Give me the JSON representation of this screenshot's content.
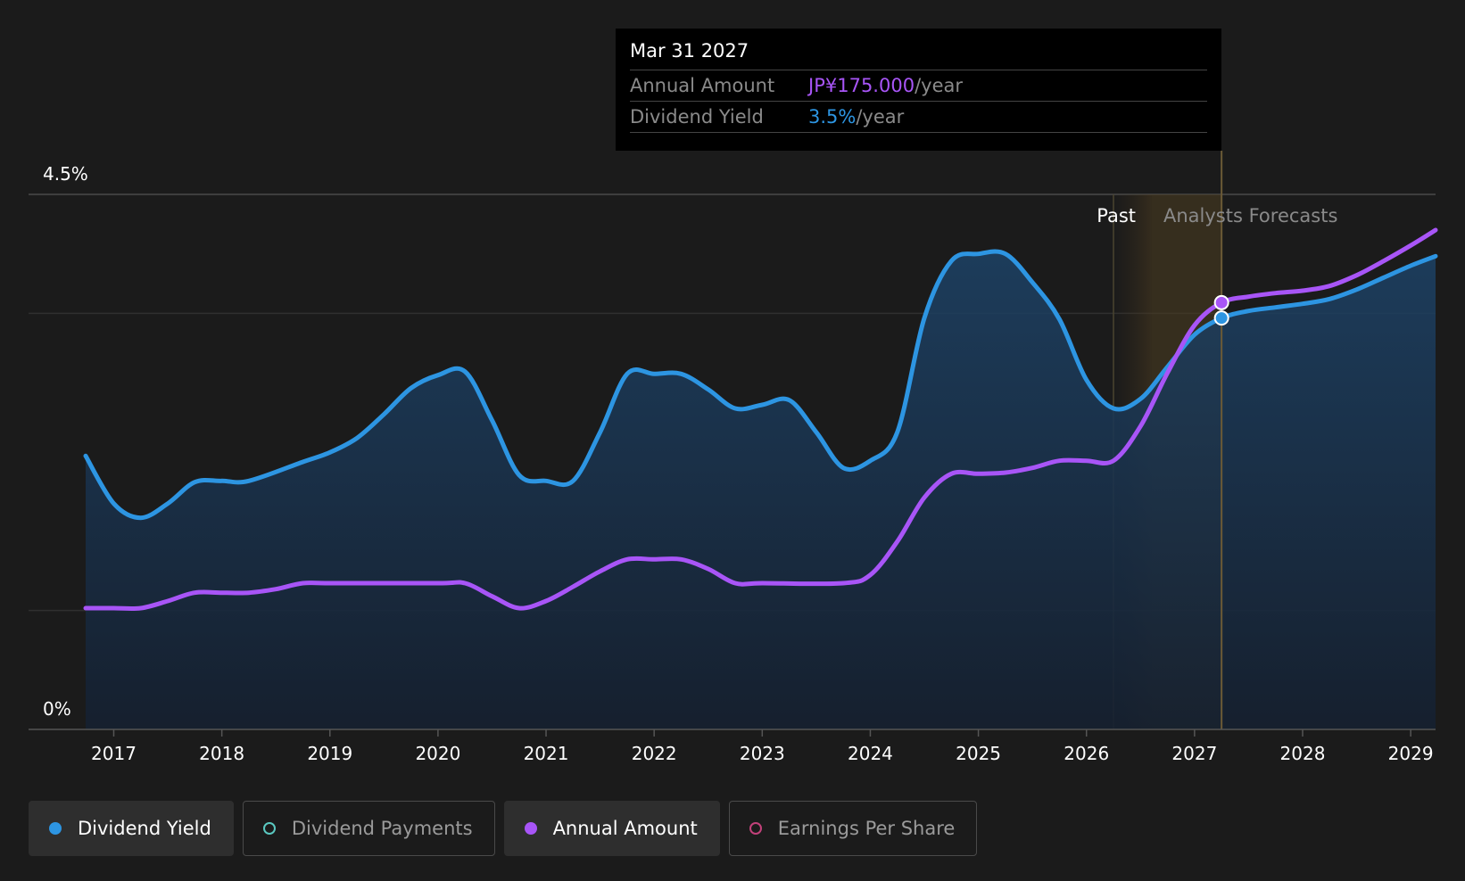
{
  "tooltip": {
    "date": "Mar 31 2027",
    "rows": [
      {
        "label": "Annual Amount",
        "value": "JP¥175.000",
        "unit": "/year"
      },
      {
        "label": "Dividend Yield",
        "value": "3.5%",
        "unit": "/year"
      }
    ]
  },
  "legend": [
    {
      "label": "Dividend Yield",
      "color": "#2d95e2",
      "filled": true,
      "active": true
    },
    {
      "label": "Dividend Payments",
      "color": "#5ac8c0",
      "filled": false,
      "active": false
    },
    {
      "label": "Annual Amount",
      "color": "#a855f7",
      "filled": true,
      "active": true
    },
    {
      "label": "Earnings Per Share",
      "color": "#c2417a",
      "filled": false,
      "active": false
    }
  ],
  "chart_data": {
    "type": "line",
    "y_labels": {
      "top": "4.5%",
      "bottom": "0%"
    },
    "ylim": [
      0,
      4.5
    ],
    "xlim": [
      2016.74,
      2029.23
    ],
    "x_ticks": [
      "2017",
      "2018",
      "2019",
      "2020",
      "2021",
      "2022",
      "2023",
      "2024",
      "2025",
      "2026",
      "2027",
      "2028",
      "2029"
    ],
    "regions": {
      "past_label": "Past",
      "forecast_label": "Analysts Forecasts",
      "past_end": 2026.25,
      "forecast_start": 2026.6,
      "cursor": 2027.25
    },
    "series": [
      {
        "name": "Dividend Yield",
        "color": "#2d95e2",
        "points": [
          [
            2016.74,
            2.3
          ],
          [
            2017.0,
            1.9
          ],
          [
            2017.25,
            1.78
          ],
          [
            2017.5,
            1.9
          ],
          [
            2017.75,
            2.08
          ],
          [
            2018.0,
            2.09
          ],
          [
            2018.25,
            2.09
          ],
          [
            2018.75,
            2.25
          ],
          [
            2019.0,
            2.33
          ],
          [
            2019.25,
            2.45
          ],
          [
            2019.5,
            2.65
          ],
          [
            2019.75,
            2.87
          ],
          [
            2020.0,
            2.98
          ],
          [
            2020.25,
            3.01
          ],
          [
            2020.5,
            2.6
          ],
          [
            2020.75,
            2.14
          ],
          [
            2021.0,
            2.09
          ],
          [
            2021.25,
            2.09
          ],
          [
            2021.5,
            2.5
          ],
          [
            2021.75,
            2.99
          ],
          [
            2022.0,
            2.99
          ],
          [
            2022.25,
            2.99
          ],
          [
            2022.5,
            2.86
          ],
          [
            2022.75,
            2.7
          ],
          [
            2023.0,
            2.73
          ],
          [
            2023.25,
            2.77
          ],
          [
            2023.5,
            2.5
          ],
          [
            2023.75,
            2.2
          ],
          [
            2024.0,
            2.26
          ],
          [
            2024.25,
            2.5
          ],
          [
            2024.5,
            3.46
          ],
          [
            2024.75,
            3.94
          ],
          [
            2025.0,
            4.0
          ],
          [
            2025.25,
            4.0
          ],
          [
            2025.5,
            3.76
          ],
          [
            2025.75,
            3.45
          ],
          [
            2026.0,
            2.94
          ],
          [
            2026.25,
            2.7
          ],
          [
            2026.5,
            2.78
          ],
          [
            2026.75,
            3.05
          ],
          [
            2027.0,
            3.32
          ],
          [
            2027.25,
            3.46
          ],
          [
            2027.5,
            3.52
          ],
          [
            2027.75,
            3.55
          ],
          [
            2028.0,
            3.58
          ],
          [
            2028.25,
            3.62
          ],
          [
            2028.5,
            3.7
          ],
          [
            2028.75,
            3.8
          ],
          [
            2029.0,
            3.9
          ],
          [
            2029.23,
            3.98
          ]
        ]
      },
      {
        "name": "Annual Amount",
        "color": "#a855f7",
        "points": [
          [
            2016.74,
            1.02
          ],
          [
            2017.0,
            1.02
          ],
          [
            2017.25,
            1.02
          ],
          [
            2017.5,
            1.08
          ],
          [
            2017.75,
            1.15
          ],
          [
            2018.0,
            1.15
          ],
          [
            2018.25,
            1.15
          ],
          [
            2018.5,
            1.18
          ],
          [
            2018.75,
            1.23
          ],
          [
            2019.0,
            1.23
          ],
          [
            2020.0,
            1.23
          ],
          [
            2020.25,
            1.23
          ],
          [
            2020.5,
            1.12
          ],
          [
            2020.75,
            1.02
          ],
          [
            2021.0,
            1.08
          ],
          [
            2021.25,
            1.2
          ],
          [
            2021.5,
            1.33
          ],
          [
            2021.75,
            1.43
          ],
          [
            2022.0,
            1.43
          ],
          [
            2022.25,
            1.43
          ],
          [
            2022.5,
            1.35
          ],
          [
            2022.75,
            1.23
          ],
          [
            2023.0,
            1.23
          ],
          [
            2023.75,
            1.23
          ],
          [
            2024.0,
            1.3
          ],
          [
            2024.25,
            1.58
          ],
          [
            2024.5,
            1.95
          ],
          [
            2024.75,
            2.15
          ],
          [
            2025.0,
            2.15
          ],
          [
            2025.25,
            2.16
          ],
          [
            2025.5,
            2.2
          ],
          [
            2025.75,
            2.26
          ],
          [
            2026.0,
            2.26
          ],
          [
            2026.25,
            2.26
          ],
          [
            2026.5,
            2.55
          ],
          [
            2026.75,
            3.0
          ],
          [
            2027.0,
            3.4
          ],
          [
            2027.25,
            3.59
          ],
          [
            2027.5,
            3.64
          ],
          [
            2027.75,
            3.67
          ],
          [
            2028.0,
            3.69
          ],
          [
            2028.25,
            3.73
          ],
          [
            2028.5,
            3.82
          ],
          [
            2028.75,
            3.94
          ],
          [
            2029.0,
            4.07
          ],
          [
            2029.23,
            4.2
          ]
        ]
      }
    ],
    "markers": [
      {
        "series": "Annual Amount",
        "x": 2027.25,
        "y": 3.59
      },
      {
        "series": "Dividend Yield",
        "x": 2027.25,
        "y": 3.46
      }
    ]
  }
}
